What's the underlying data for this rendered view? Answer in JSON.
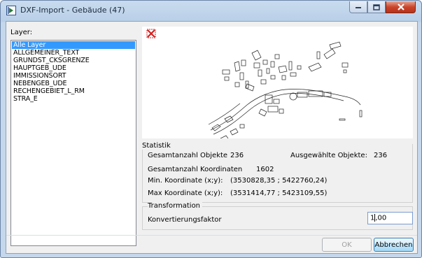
{
  "window": {
    "title": "DXF-Import - Gebäude (47)"
  },
  "layers": {
    "label": "Layer:",
    "items": [
      {
        "label": "Alle Layer",
        "selected": true
      },
      {
        "label": "ALLGEMEINER_TEXT",
        "selected": false
      },
      {
        "label": "GRUNDST_CKSGRENZE",
        "selected": false
      },
      {
        "label": "HAUPTGEB_UDE",
        "selected": false
      },
      {
        "label": "IMMISSIONSORT",
        "selected": false
      },
      {
        "label": "NEBENGEB_UDE",
        "selected": false
      },
      {
        "label": "RECHENGEBIET_L_RM",
        "selected": false
      },
      {
        "label": "STRA_E",
        "selected": false
      }
    ]
  },
  "preview": {
    "icon": "close-red-x-icon"
  },
  "statistik": {
    "legend": "Statistik",
    "total_objects_label": "Gesamtanzahl Objekte",
    "total_objects_value": "236",
    "selected_objects_label": "Ausgewählte Objekte:",
    "selected_objects_value": "236",
    "total_coords_label": "Gesamtanzahl Koordinaten",
    "total_coords_value": "1602",
    "min_coord_label": "Min. Koordinate (x;y):",
    "min_coord_value": "(3530828,35 ; 5422760,24)",
    "max_coord_label": "Max Koordinate (x;y):",
    "max_coord_value": "(3531414,77 ; 5423109,55)"
  },
  "transformation": {
    "legend": "Transformation",
    "factor_label": "Konvertierungsfaktor",
    "factor_value_before_caret": "1",
    "factor_value_after_caret": ",00"
  },
  "buttons": {
    "ok": "OK",
    "cancel": "Abbrechen"
  },
  "colors": {
    "selection": "#3399ff",
    "close_button": "#c9452c",
    "preview_icon": "#d62020"
  }
}
